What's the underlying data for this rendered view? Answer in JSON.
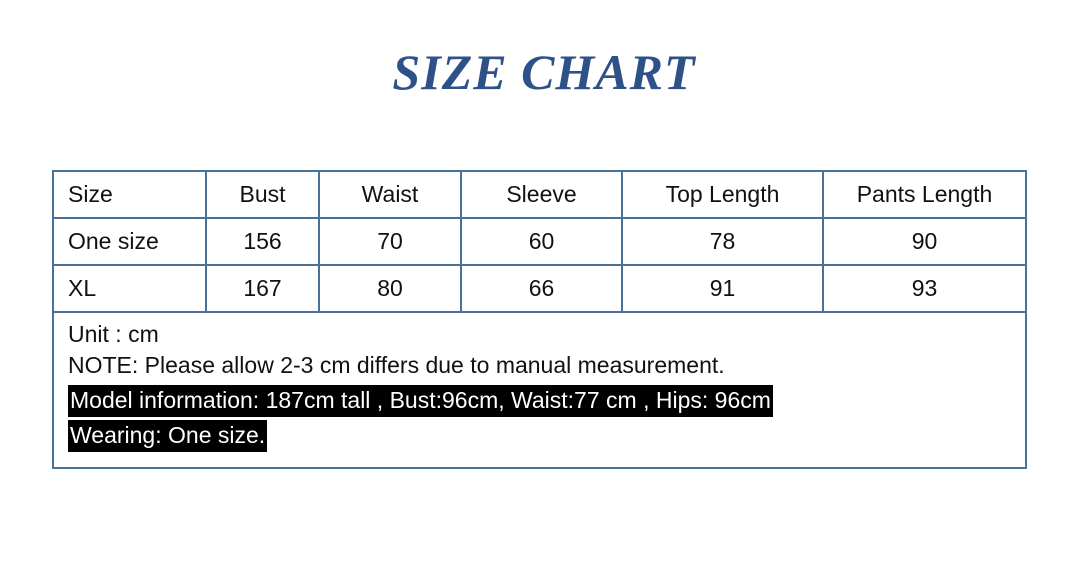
{
  "title": "SIZE CHART",
  "colors": {
    "title": "#2E5288",
    "table_border": "#4A7296",
    "highlight_bg": "#000000",
    "highlight_text": "#ffffff",
    "text": "#111111",
    "page_bg": "#ffffff"
  },
  "table": {
    "headers": [
      "Size",
      "Bust",
      "Waist",
      "Sleeve",
      "Top Length",
      "Pants Length"
    ],
    "rows": [
      {
        "cells": [
          "One size",
          "156",
          "70",
          "60",
          "78",
          "90"
        ]
      },
      {
        "cells": [
          "XL",
          "167",
          "80",
          "66",
          "91",
          "93"
        ]
      }
    ]
  },
  "notes": {
    "unit": "Unit : cm",
    "note": "NOTE: Please allow 2-3 cm differs due to manual measurement.",
    "model_info": "Model information: 187cm tall , Bust:96cm, Waist:77 cm , Hips: 96cm",
    "wearing": "Wearing: One size."
  },
  "chart_data": {
    "type": "table",
    "title": "SIZE CHART",
    "columns": [
      "Size",
      "Bust",
      "Waist",
      "Sleeve",
      "Top Length",
      "Pants Length"
    ],
    "rows": [
      [
        "One size",
        156,
        70,
        60,
        78,
        90
      ],
      [
        "XL",
        167,
        80,
        66,
        91,
        93
      ]
    ],
    "unit": "cm",
    "annotations": [
      "Unit : cm",
      "NOTE: Please allow 2-3 cm differs due to manual measurement.",
      "Model information: 187cm tall , Bust:96cm, Waist:77 cm , Hips: 96cm",
      "Wearing: One size."
    ]
  }
}
